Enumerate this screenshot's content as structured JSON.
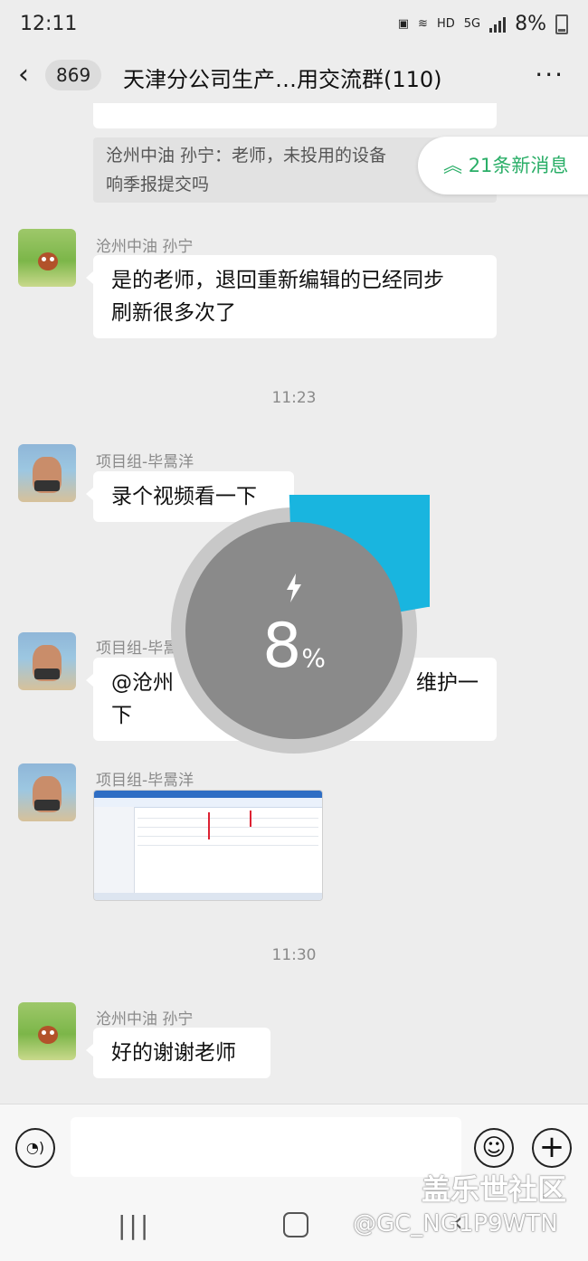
{
  "status_bar": {
    "time": "12:11",
    "network": "HD",
    "signal": "5G",
    "battery_text": "8%"
  },
  "header": {
    "back_icon": "back-chevron-icon",
    "unread_count": "869",
    "title": "天津分公司生产…用交流群(110)",
    "more_icon": "more-icon"
  },
  "new_messages_pill": "21条新消息",
  "messages": [
    {
      "type": "quote",
      "lines": [
        "沧州中油 孙宁：老师，未投用的设备",
        "响季报提交吗"
      ]
    },
    {
      "type": "text",
      "sender": "沧州中油 孙宁",
      "lines": [
        "是的老师，退回重新编辑的已经同步",
        "刷新很多次了"
      ]
    },
    {
      "type": "time",
      "text": "11:23"
    },
    {
      "type": "text",
      "sender": "项目组-毕暠洋",
      "lines": [
        "录个视频看一下"
      ]
    },
    {
      "type": "text",
      "sender": "项目组-毕暠洋",
      "lines": [
        "@沧州",
        "维护一",
        "下"
      ]
    },
    {
      "type": "image",
      "sender": "项目组-毕暠洋"
    },
    {
      "type": "time",
      "text": "11:30"
    },
    {
      "type": "text",
      "sender": "沧州中油 孙宁",
      "lines": [
        "好的谢谢老师"
      ]
    }
  ],
  "charging_overlay": {
    "value": "8",
    "unit": "%",
    "level_fraction": 0.08,
    "ring_color": "#19b5df",
    "track_color": "#c8c8c8"
  },
  "input_bar": {
    "voice_icon": "voice-icon",
    "emoji_icon": "emoji-icon",
    "plus_icon": "plus-icon"
  },
  "nav": {
    "recents_icon": "recents-icon",
    "home_icon": "home-icon",
    "back_icon": "nav-back-icon"
  },
  "watermark": {
    "site": "盖乐世社区",
    "user": "@GC_NG1P9WTN"
  },
  "colors": {
    "accent_green": "#2aae67",
    "background": "#ededed"
  }
}
